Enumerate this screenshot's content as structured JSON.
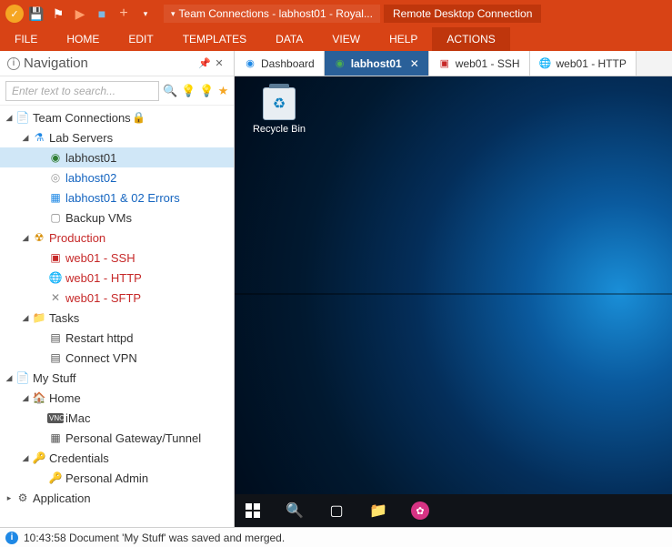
{
  "titlebar": {
    "doc_button": "Team Connections - labhost01 - Royal...",
    "context_tab": "Remote Desktop Connection"
  },
  "menu": {
    "file": "FILE",
    "home": "HOME",
    "edit": "EDIT",
    "templates": "TEMPLATES",
    "data": "DATA",
    "view": "VIEW",
    "help": "HELP",
    "actions": "ACTIONS"
  },
  "nav": {
    "title": "Navigation",
    "search_placeholder": "Enter text to search...",
    "tree": {
      "team_connections": "Team Connections",
      "lab_servers": "Lab Servers",
      "labhost01": "labhost01",
      "labhost02": "labhost02",
      "labhost_errors": "labhost01 & 02 Errors",
      "backup_vms": "Backup VMs",
      "production": "Production",
      "web01_ssh": "web01 - SSH",
      "web01_http": "web01 - HTTP",
      "web01_sftp": "web01 - SFTP",
      "tasks": "Tasks",
      "restart_httpd": "Restart httpd",
      "connect_vpn": "Connect VPN",
      "my_stuff": "My Stuff",
      "home": "Home",
      "imac": "iMac",
      "gateway": "Personal Gateway/Tunnel",
      "credentials": "Credentials",
      "personal_admin": "Personal Admin",
      "application": "Application"
    }
  },
  "tabs": {
    "dashboard": "Dashboard",
    "labhost01": "labhost01",
    "web01_ssh": "web01 - SSH",
    "web01_http": "web01 - HTTP"
  },
  "desktop": {
    "recycle_bin": "Recycle Bin"
  },
  "status": {
    "message": "10:43:58 Document 'My Stuff' was saved and merged."
  }
}
